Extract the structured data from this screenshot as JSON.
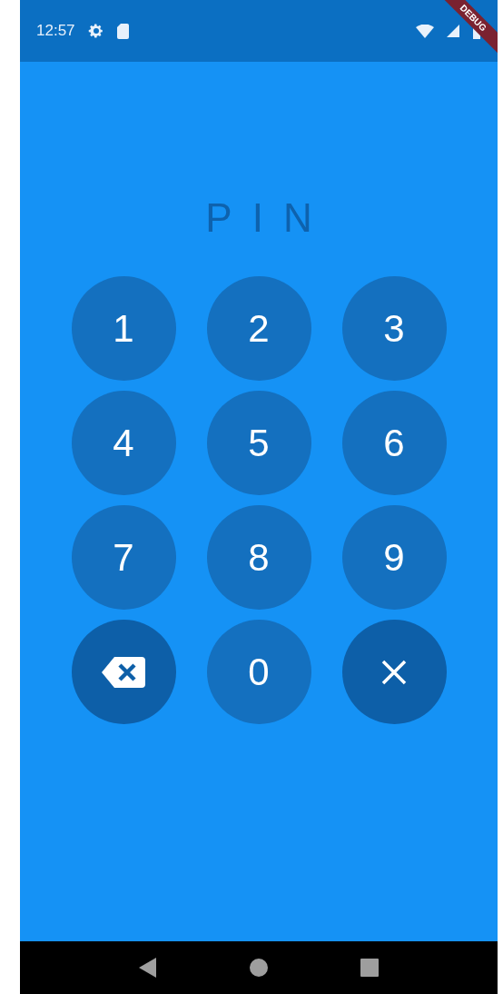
{
  "status_bar": {
    "time": "12:57"
  },
  "debug_banner": {
    "label": "DEBUG"
  },
  "title": "PIN",
  "keys": [
    {
      "kind": "digit",
      "label": "1"
    },
    {
      "kind": "digit",
      "label": "2"
    },
    {
      "kind": "digit",
      "label": "3"
    },
    {
      "kind": "digit",
      "label": "4"
    },
    {
      "kind": "digit",
      "label": "5"
    },
    {
      "kind": "digit",
      "label": "6"
    },
    {
      "kind": "digit",
      "label": "7"
    },
    {
      "kind": "digit",
      "label": "8"
    },
    {
      "kind": "digit",
      "label": "9"
    },
    {
      "kind": "backspace"
    },
    {
      "kind": "digit",
      "label": "0"
    },
    {
      "kind": "cancel"
    }
  ]
}
